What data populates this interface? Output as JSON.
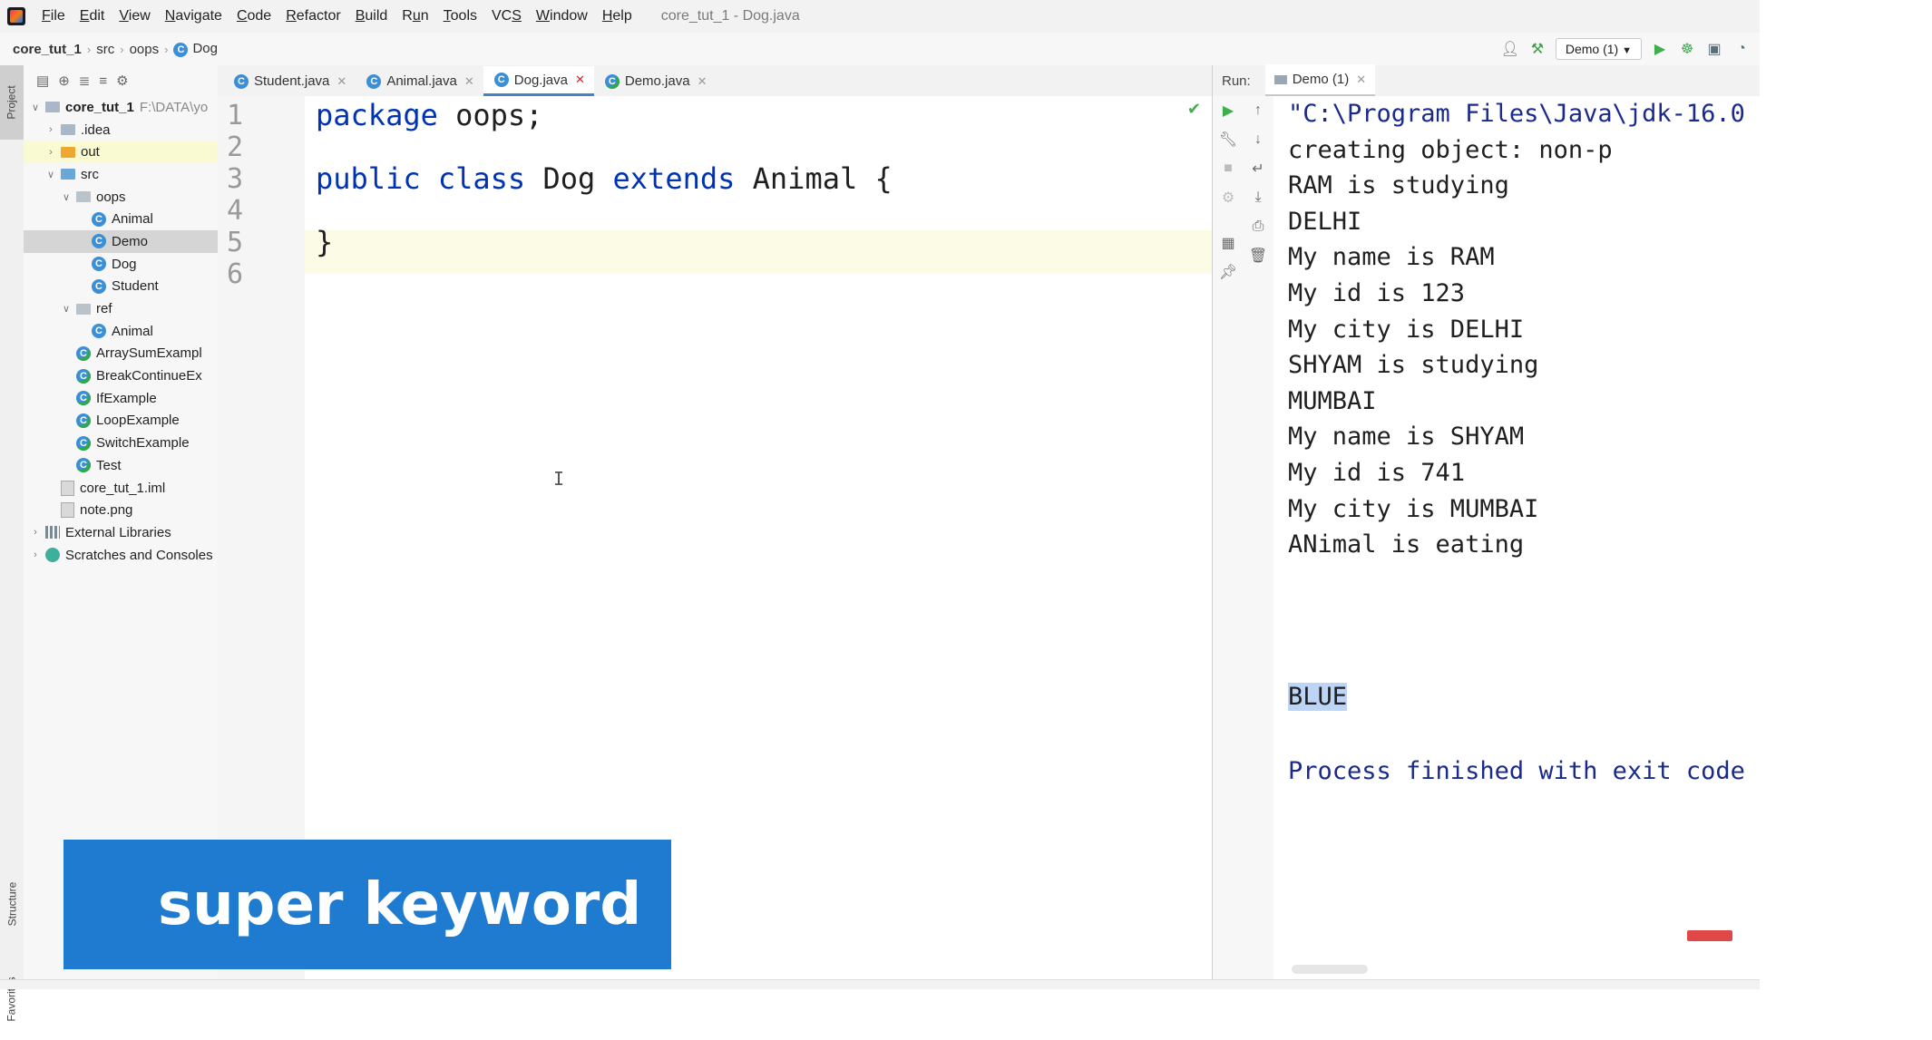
{
  "app": {
    "window_title": "core_tut_1 - Dog.java",
    "menu": [
      {
        "pre": "",
        "u": "F",
        "post": "ile"
      },
      {
        "pre": "",
        "u": "E",
        "post": "dit"
      },
      {
        "pre": "",
        "u": "V",
        "post": "iew"
      },
      {
        "pre": "",
        "u": "N",
        "post": "avigate"
      },
      {
        "pre": "",
        "u": "C",
        "post": "ode"
      },
      {
        "pre": "",
        "u": "R",
        "post": "efactor"
      },
      {
        "pre": "",
        "u": "B",
        "post": "uild"
      },
      {
        "pre": "R",
        "u": "u",
        "post": "n"
      },
      {
        "pre": "",
        "u": "T",
        "post": "ools"
      },
      {
        "pre": "VC",
        "u": "S",
        "post": ""
      },
      {
        "pre": "",
        "u": "W",
        "post": "indow"
      },
      {
        "pre": "",
        "u": "H",
        "post": "elp"
      }
    ]
  },
  "breadcrumb": [
    "core_tut_1",
    "src",
    "oops",
    "Dog"
  ],
  "run_config": "Demo (1)",
  "side_tabs": {
    "project": "Project",
    "structure": "Structure",
    "favorites": "Favorites"
  },
  "project_tree": [
    {
      "depth": 0,
      "arrow": "down",
      "icon": "folder",
      "label": "core_tut_1",
      "extra": "F:\\DATA\\yo",
      "bold": true
    },
    {
      "depth": 1,
      "arrow": "right",
      "icon": "folder",
      "label": ".idea"
    },
    {
      "depth": 1,
      "arrow": "right",
      "icon": "folder-orange",
      "label": "out",
      "state": "highlight"
    },
    {
      "depth": 1,
      "arrow": "down",
      "icon": "folder-blue",
      "label": "src"
    },
    {
      "depth": 2,
      "arrow": "down",
      "icon": "package",
      "label": "oops"
    },
    {
      "depth": 3,
      "arrow": "",
      "icon": "class",
      "label": "Animal"
    },
    {
      "depth": 3,
      "arrow": "",
      "icon": "class",
      "label": "Demo",
      "state": "selected"
    },
    {
      "depth": 3,
      "arrow": "",
      "icon": "class",
      "label": "Dog"
    },
    {
      "depth": 3,
      "arrow": "",
      "icon": "class",
      "label": "Student"
    },
    {
      "depth": 2,
      "arrow": "down",
      "icon": "package",
      "label": "ref"
    },
    {
      "depth": 3,
      "arrow": "",
      "icon": "class",
      "label": "Animal"
    },
    {
      "depth": 2,
      "arrow": "",
      "icon": "class-main",
      "label": "ArraySumExampl"
    },
    {
      "depth": 2,
      "arrow": "",
      "icon": "class-main",
      "label": "BreakContinueEx"
    },
    {
      "depth": 2,
      "arrow": "",
      "icon": "class-main",
      "label": "IfExample"
    },
    {
      "depth": 2,
      "arrow": "",
      "icon": "class-main",
      "label": "LoopExample"
    },
    {
      "depth": 2,
      "arrow": "",
      "icon": "class-main",
      "label": "SwitchExample"
    },
    {
      "depth": 2,
      "arrow": "",
      "icon": "class-main",
      "label": "Test"
    },
    {
      "depth": 1,
      "arrow": "",
      "icon": "file",
      "label": "core_tut_1.iml"
    },
    {
      "depth": 1,
      "arrow": "",
      "icon": "file",
      "label": "note.png"
    },
    {
      "depth": 0,
      "arrow": "right",
      "icon": "library",
      "label": "External Libraries"
    },
    {
      "depth": 0,
      "arrow": "right",
      "icon": "scratch",
      "label": "Scratches and Consoles"
    }
  ],
  "editor_tabs": [
    {
      "label": "Student.java",
      "active": false
    },
    {
      "label": "Animal.java",
      "active": false
    },
    {
      "label": "Dog.java",
      "active": true
    },
    {
      "label": "Demo.java",
      "active": false
    }
  ],
  "line_numbers": [
    "1",
    "2",
    "3",
    "4",
    "5",
    "6"
  ],
  "code": {
    "line1": {
      "kw": "package",
      "rest": " oops;"
    },
    "line3": {
      "kw1": "public",
      "kw2": "class",
      "name": "Dog",
      "kw3": "extends",
      "rest": "Animal {"
    },
    "line5": "}"
  },
  "caret_glyph": "I",
  "run": {
    "label": "Run:",
    "tab": "Demo (1)",
    "output": [
      "\"C:\\Program Files\\Java\\jdk-16.0",
      "creating object: non-p",
      "RAM is studying",
      "DELHI",
      "My name is RAM",
      "My id is 123",
      "My city is DELHI",
      "SHYAM is studying",
      "MUMBAI",
      "My name is SHYAM",
      "My id is 741",
      "My city is MUMBAI",
      "ANimal is eating"
    ],
    "selected_line": "BLUE",
    "finished": "Process finished with exit code"
  },
  "banner": {
    "text": "super keyword",
    "color": "#1e7bd0"
  },
  "colors": {
    "keyword": "#0033b3",
    "selection": "#bcd4f5",
    "accent": "#4083c9"
  }
}
